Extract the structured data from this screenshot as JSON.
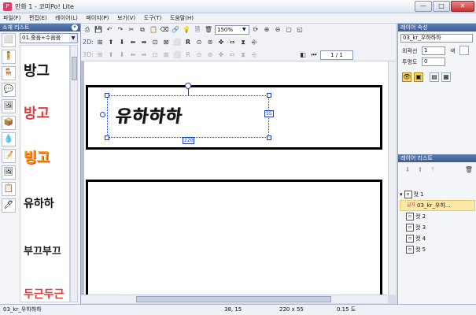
{
  "window": {
    "title": "만화 1 - 코미Po! Lite",
    "min": "—",
    "max": "□",
    "close": "✕"
  },
  "menu": [
    "파일(F)",
    "편집(E)",
    "레이어(L)",
    "페이지(P)",
    "보기(V)",
    "도구(T)",
    "도움말(H)"
  ],
  "left_panel": {
    "title": "소재 리스트",
    "category": "01.중음+수음음",
    "icons": [
      "⬜",
      "🧍",
      "🪑",
      "💬",
      "🖼",
      "📦",
      "💧",
      "📝",
      "🖼",
      "📋",
      "🖊"
    ],
    "stickers": [
      "방그",
      "방고",
      "빙고",
      "유하하",
      "부끄부끄",
      "두근두근"
    ]
  },
  "toolbar": {
    "zoom": "150%",
    "page": "1 / 1",
    "row_2d_label": "2D:",
    "row_3d_label": "3D:",
    "row1_icons": [
      "⎙",
      "💾",
      "↶",
      "↷",
      "✂",
      "⧉",
      "📋",
      "⌫",
      "🔗",
      "💡",
      "🗎",
      "🗑",
      "⌖",
      "⟳",
      "⊕",
      "⊖",
      "▢",
      "◱",
      "⛶"
    ],
    "row2_icons": [
      "⊞",
      "⬆",
      "⬇",
      "⬅",
      "➡",
      "⊡",
      "⊠",
      "⬜",
      "R",
      "⊙",
      "⊚",
      "✤",
      "⇔",
      "⧗",
      "⎆"
    ],
    "row3_icons": [
      "⊞",
      "⬆",
      "⬇",
      "⬅",
      "➡",
      "⊡",
      "⊠",
      "⬜",
      "R",
      "⊙",
      "⊚",
      "✤",
      "⇔",
      "⧗",
      "⎆"
    ]
  },
  "canvas": {
    "balloon_text": "유하하하",
    "label_55": "55",
    "label_220": "220"
  },
  "right_panel": {
    "layer_props_title": "레이어 속성",
    "layer_name": "03_kr_우하하하",
    "outline_label": "외곽선",
    "outline_value": "1",
    "color_label": "색",
    "opacity_label": "투명도",
    "opacity_value": "0",
    "layer_list_title": "레이어 리스트",
    "layers": [
      {
        "label": "컷 1",
        "indent": 0,
        "selected": false,
        "expand": "▾"
      },
      {
        "label": "03_kr_우하…",
        "indent": 1,
        "selected": true,
        "tag": "글자"
      },
      {
        "label": "컷 2",
        "indent": 0,
        "selected": false
      },
      {
        "label": "컷 3",
        "indent": 0,
        "selected": false
      },
      {
        "label": "컷 4",
        "indent": 0,
        "selected": false
      },
      {
        "label": "컷 5",
        "indent": 0,
        "selected": false
      }
    ]
  },
  "status": {
    "name": "03_kr_우하하하",
    "coords": "38, 15",
    "size": "220 x 55",
    "angle": "0.15 도"
  }
}
